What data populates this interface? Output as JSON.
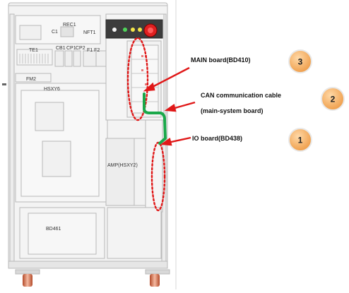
{
  "cabinet_labels": {
    "rec1": "REC1",
    "c1": "C1",
    "nft1": "NFT1",
    "te1": "TE1",
    "cb1": "CB1",
    "cp1": "CP1",
    "cp2": "CP2",
    "f1f2": "F1 F2",
    "fm2": "FM2",
    "hsxy6": "HSXY6",
    "amp": "AMP(HSXY2)",
    "bd461": "BD461"
  },
  "callouts": [
    {
      "number": "3",
      "text": "MAIN board(BD410)"
    },
    {
      "number": "2",
      "text": "CAN communication cable",
      "subtext": "(main-system board)"
    },
    {
      "number": "1",
      "text": "IO board(BD438)"
    }
  ],
  "colors": {
    "callout_circle": "#f0a04a",
    "callout_circle_edge": "#d8843a",
    "highlight_dots": "#e01818",
    "arrow": "#e01818",
    "cable": "#1aa84a",
    "cabinet_line": "#b4b4b4",
    "caster": "#d2765a"
  }
}
